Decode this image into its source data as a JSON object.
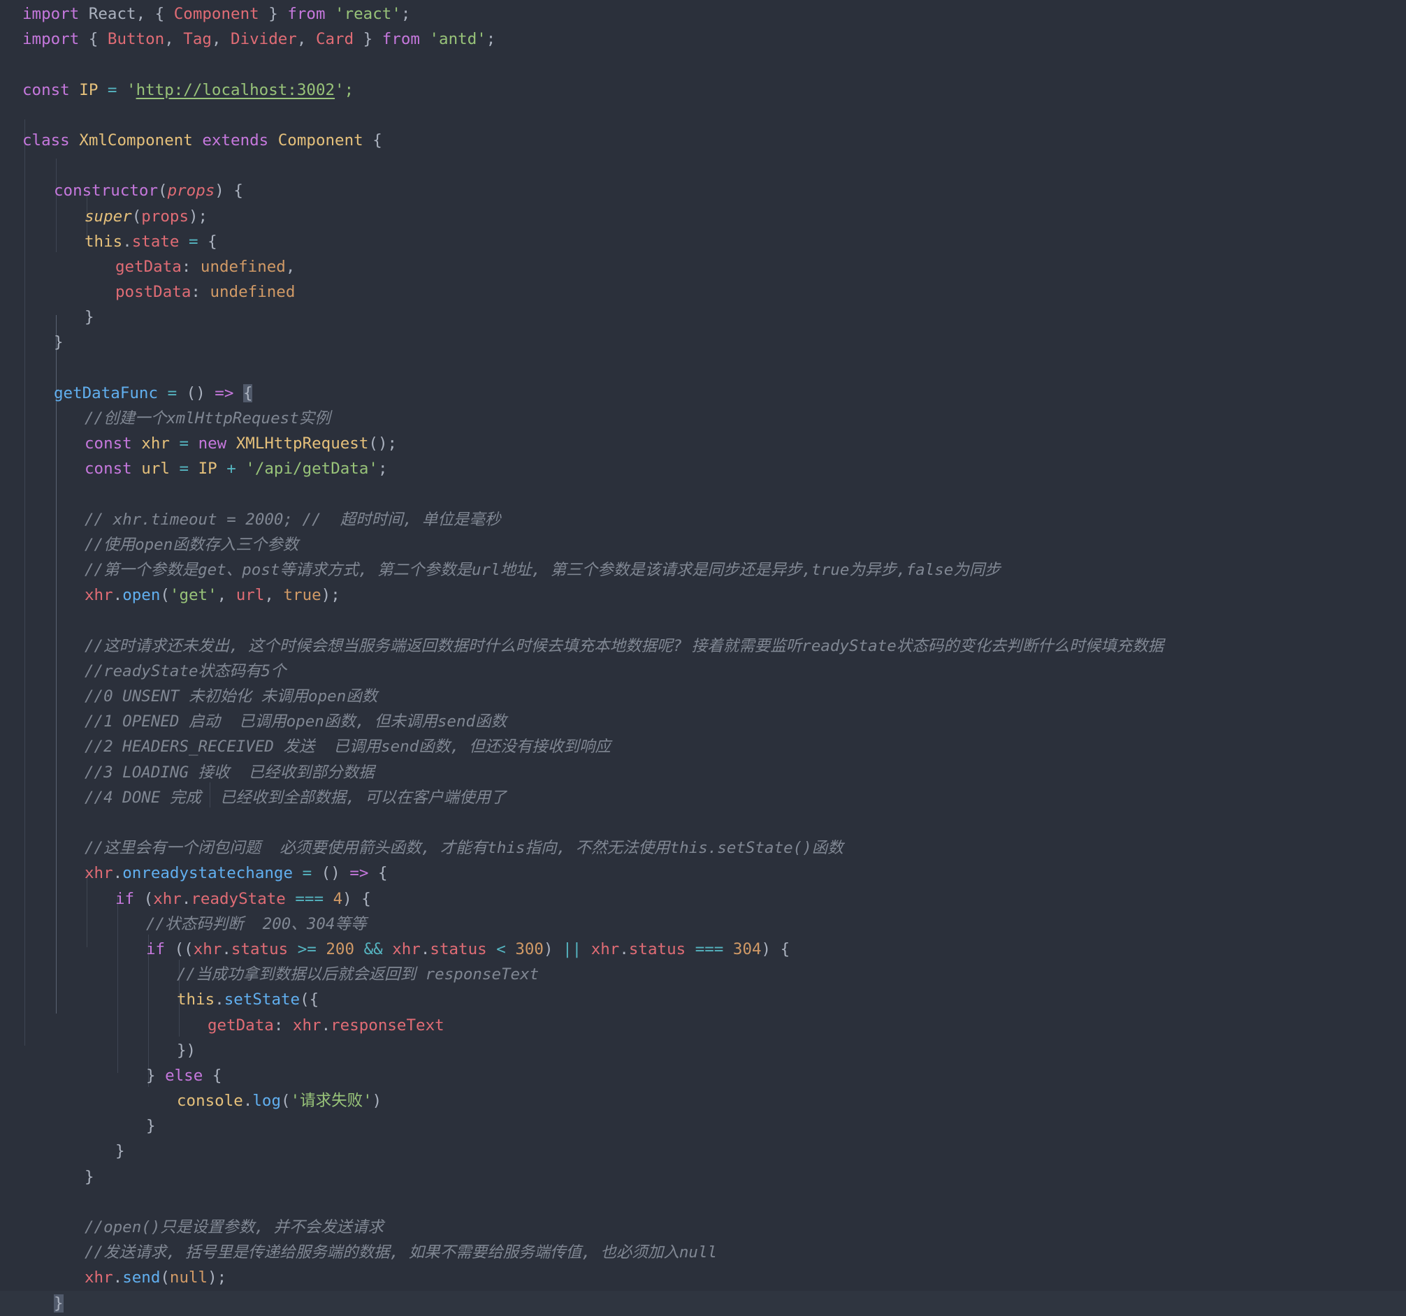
{
  "editor": {
    "theme": "one-dark",
    "background": "#2b303b",
    "language": "javascript-jsx",
    "colors": {
      "keyword": "#c678dd",
      "string": "#98c379",
      "property": "#e06c75",
      "function": "#61afef",
      "number": "#d19a66",
      "class": "#e5c07b",
      "operator": "#56b6c2",
      "comment": "#808793",
      "punctuation": "#abb2bf",
      "bracket_match_bg": "#515a6b",
      "active_line_bg": "#2f3540",
      "indent_guide": "#3f4653"
    }
  },
  "code": {
    "lines": [
      "import React, { Component } from 'react';",
      "import { Button, Tag, Divider, Card } from 'antd';",
      "",
      "const IP = 'http://localhost:3002';",
      "",
      "class XmlComponent extends Component {",
      "",
      "    constructor(props) {",
      "        super(props);",
      "        this.state = {",
      "            getData: undefined,",
      "            postData: undefined",
      "        }",
      "    }",
      "",
      "    getDataFunc = () => {",
      "        //创建一个xmlHttpRequest实例",
      "        const xhr = new XMLHttpRequest();",
      "        const url = IP + '/api/getData';",
      "",
      "        // xhr.timeout = 2000; //  超时时间, 单位是毫秒",
      "        //使用open函数存入三个参数",
      "        //第一个参数是get、post等请求方式, 第二个参数是url地址, 第三个参数是该请求是同步还是异步,true为异步,false为同步",
      "        xhr.open('get', url, true);",
      "",
      "        //这时请求还未发出, 这个时候会想当服务端返回数据时什么时候去填充本地数据呢? 接着就需要监听readyState状态码的变化去判断什么时候填充数据",
      "        //readyState状态码有5个",
      "        //0 UNSENT 未初始化 未调用open函数",
      "        //1 OPENED 启动  已调用open函数, 但未调用send函数",
      "        //2 HEADERS_RECEIVED 发送  已调用send函数, 但还没有接收到响应",
      "        //3 LOADING 接收  已经收到部分数据",
      "        //4 DONE 完成  已经收到全部数据, 可以在客户端使用了",
      "",
      "        //这里会有一个闭包问题  必须要使用箭头函数, 才能有this指向, 不然无法使用this.setState()函数",
      "        xhr.onreadystatechange = () => {",
      "            if (xhr.readyState === 4) {",
      "                //状态码判断  200、304等等",
      "                if ((xhr.status >= 200 && xhr.status < 300) || xhr.status === 304) {",
      "                    //当成功拿到数据以后就会返回到 responseText",
      "                    this.setState({",
      "                        getData: xhr.responseText",
      "                    })",
      "                } else {",
      "                    console.log('请求失败')",
      "                }",
      "            }",
      "        }",
      "",
      "        //open()只是设置参数, 并不会发送请求",
      "        //发送请求, 括号里是传递给服务端的数据, 如果不需要给服务端传值, 也必须加入null",
      "        xhr.send(null);",
      "    }"
    ],
    "url_string": "http://localhost:3002",
    "comments_zh": [
      "//创建一个xmlHttpRequest实例",
      "// xhr.timeout = 2000; //  超时时间, 单位是毫秒",
      "//使用open函数存入三个参数",
      "//第一个参数是get、post等请求方式, 第二个参数是url地址, 第三个参数是该请求是同步还是异步,true为异步,false为同步",
      "//这时请求还未发出, 这个时候会想当服务端返回数据时什么时候去填充本地数据呢? 接着就需要监听readyState状态码的变化去判断什么时候填充数据",
      "//readyState状态码有5个",
      "//0 UNSENT 未初始化 未调用open函数",
      "//1 OPENED 启动  已调用open函数, 但未调用send函数",
      "//2 HEADERS_RECEIVED 发送  已调用send函数, 但还没有接收到响应",
      "//3 LOADING 接收  已经收到部分数据",
      "//4 DONE 完成  已经收到全部数据, 可以在客户端使用了",
      "//这里会有一个闭包问题  必须要使用箭头函数, 才能有this指向, 不然无法使用this.setState()函数",
      "//状态码判断  200、304等等",
      "//当成功拿到数据以后就会返回到 responseText",
      "//open()只是设置参数, 并不会发送请求",
      "//发送请求, 括号里是传递给服务端的数据, 如果不需要给服务端传值, 也必须加入null"
    ],
    "strings": [
      "'react'",
      "'antd'",
      "'http://localhost:3002'",
      "'/api/getData'",
      "'get'",
      "'请求失败'"
    ],
    "identifiers": {
      "class_name": "XmlComponent",
      "base_class": "Component",
      "const_ip": "IP",
      "method": "getDataFunc",
      "xhr_var": "xhr",
      "url_var": "url",
      "state_keys": [
        "getData",
        "postData"
      ],
      "status_codes": [
        "200",
        "300",
        "304",
        "4"
      ]
    }
  },
  "tokens": {
    "l1": {
      "a": "import",
      "b": " React",
      "c": ", { ",
      "d": "Component",
      "e": " } ",
      "f": "from",
      "g": " ",
      "h": "'react'",
      "i": ";"
    },
    "l2": {
      "a": "import",
      "b": " { ",
      "c": "Button",
      "d": ", ",
      "e": "Tag",
      "f": ", ",
      "g": "Divider",
      "h": ", ",
      "i": "Card",
      "j": " } ",
      "k": "from",
      "l": " ",
      "m": "'antd'",
      "n": ";"
    },
    "l4": {
      "a": "const",
      "b": " ",
      "c": "IP",
      "d": " ",
      "e": "=",
      "f": " '",
      "g": "http://localhost:3002",
      "h": "';"
    },
    "l6": {
      "a": "class",
      "b": " ",
      "c": "XmlComponent",
      "d": " ",
      "e": "extends",
      "f": " ",
      "g": "Component",
      "h": " {"
    },
    "l8": {
      "a": "constructor",
      "b": "(",
      "c": "props",
      "d": ") {"
    },
    "l9": {
      "a": "super",
      "b": "(",
      "c": "props",
      "d": ");"
    },
    "l10": {
      "a": "this",
      "b": ".",
      "c": "state",
      "d": " ",
      "e": "=",
      "f": " {"
    },
    "l11": {
      "a": "getData",
      "b": ": ",
      "c": "undefined",
      "d": ","
    },
    "l12": {
      "a": "postData",
      "b": ": ",
      "c": "undefined"
    },
    "l16": {
      "a": "getDataFunc",
      "b": " ",
      "c": "=",
      "d": " () ",
      "e": "=>",
      "f": " ",
      "g": "{"
    },
    "l18": {
      "a": "const",
      "b": " ",
      "c": "xhr",
      "d": " ",
      "e": "=",
      "f": " ",
      "g": "new",
      "h": " ",
      "i": "XMLHttpRequest",
      "j": "();"
    },
    "l19": {
      "a": "const",
      "b": " ",
      "c": "url",
      "d": " ",
      "e": "=",
      "f": " ",
      "g": "IP",
      "h": " ",
      "i": "+",
      "j": " ",
      "k": "'/api/getData'",
      "l": ";"
    },
    "l24": {
      "a": "xhr",
      "b": ".",
      "c": "open",
      "d": "(",
      "e": "'get'",
      "f": ", ",
      "g": "url",
      "h": ", ",
      "i": "true",
      "j": ");"
    },
    "l35": {
      "a": "xhr",
      "b": ".",
      "c": "onreadystatechange",
      "d": " ",
      "e": "=",
      "f": " () ",
      "g": "=>",
      "h": " {"
    },
    "l36": {
      "a": "if",
      "b": " (",
      "c": "xhr",
      "d": ".",
      "e": "readyState",
      "f": " ",
      "g": "===",
      "h": " ",
      "i": "4",
      "j": ") {"
    },
    "l38": {
      "a": "if",
      "b": " ((",
      "c": "xhr",
      "d": ".",
      "e": "status",
      "f": " ",
      "g": ">=",
      "h": " ",
      "i": "200",
      "j": " ",
      "k": "&&",
      "l": " ",
      "m": "xhr",
      "n": ".",
      "o": "status",
      "p": " ",
      "q": "<",
      "r": " ",
      "s": "300",
      "t": ") ",
      "u": "||",
      "v": " ",
      "w": "xhr",
      "x": ".",
      "y": "status",
      "z": " ",
      "aa": "===",
      "ab": " ",
      "ac": "304",
      "ad": ") {"
    },
    "l40": {
      "a": "this",
      "b": ".",
      "c": "setState",
      "d": "({"
    },
    "l41": {
      "a": "getData",
      "b": ": ",
      "c": "xhr",
      "d": ".",
      "e": "responseText"
    },
    "l43": {
      "a": "} ",
      "b": "else",
      "c": " {"
    },
    "l44": {
      "a": "console",
      "b": ".",
      "c": "log",
      "d": "(",
      "e": "'请求失败'",
      "f": ")"
    },
    "l50": {
      "a": "xhr",
      "b": ".",
      "c": "send",
      "d": "(",
      "e": "null",
      "f": ");"
    }
  }
}
